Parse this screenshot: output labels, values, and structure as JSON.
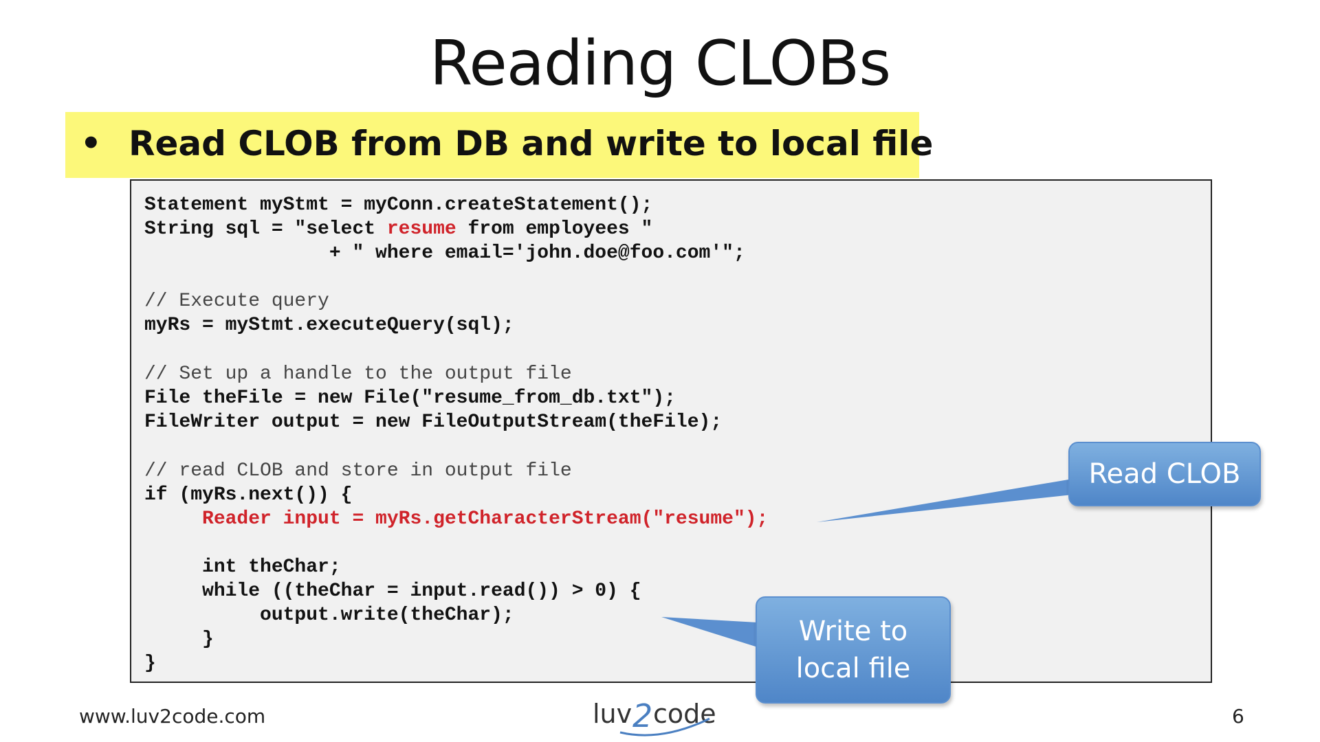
{
  "slide": {
    "title": "Reading CLOBs",
    "bullet": "Read CLOB from DB and write to local file",
    "footer_url": "www.luv2code.com",
    "page_number": "6",
    "logo_text": "luv2code"
  },
  "code": {
    "line1": "Statement myStmt = myConn.createStatement();",
    "line2_a": "String sql = \"select ",
    "line2_hl": "resume",
    "line2_b": " from employees \"",
    "line3": "                + \" where email='john.doe@foo.com'\";",
    "line4": "// Execute query",
    "line5": "myRs = myStmt.executeQuery(sql);",
    "line6": "// Set up a handle to the output file",
    "line7": "File theFile = new File(\"resume_from_db.txt\");",
    "line8": "FileWriter output = new FileOutputStream(theFile);",
    "line9": "// read CLOB and store in output file",
    "line10": "if (myRs.next()) {",
    "line11": "     Reader input = myRs.getCharacterStream(\"resume\");",
    "line12": "     int theChar;",
    "line13": "     while ((theChar = input.read()) > 0) {",
    "line14": "          output.write(theChar);",
    "line15": "     }",
    "line16": "}"
  },
  "callouts": {
    "read_clob": "Read CLOB",
    "write_line1": "Write to",
    "write_line2": "local file"
  },
  "colors": {
    "bullet_highlight": "#fcf87a",
    "code_highlight": "#d0232a",
    "callout_fill": "#5b8fcf"
  }
}
